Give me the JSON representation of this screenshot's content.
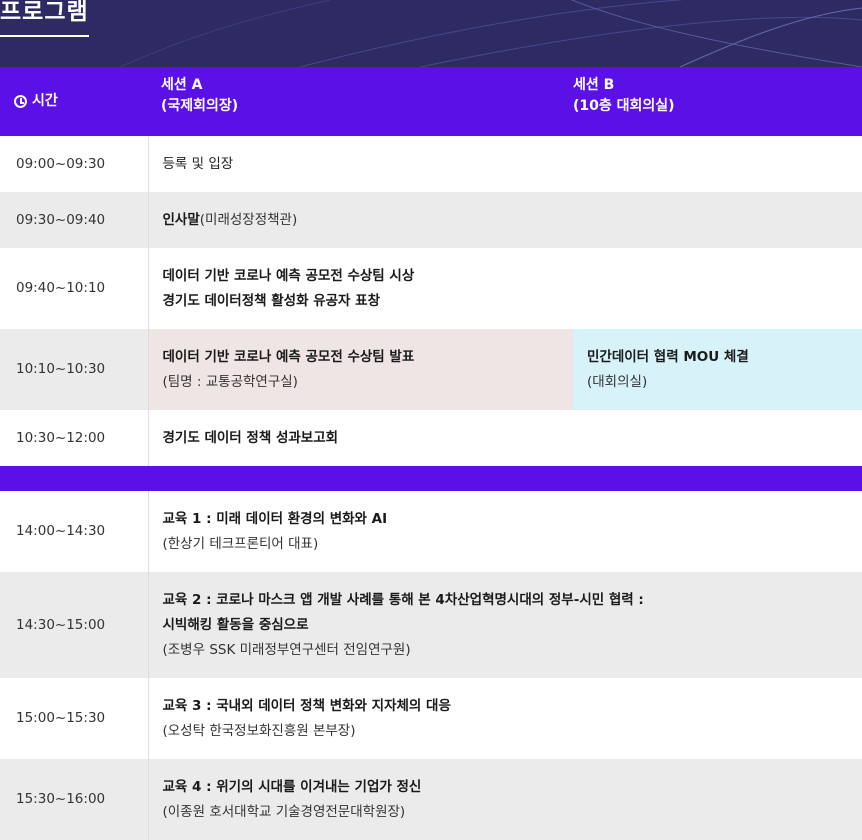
{
  "header": {
    "title": "프로그램"
  },
  "table": {
    "time_header": "시간",
    "session_a_header": [
      "세션 A",
      "(국제회의장)"
    ],
    "session_b_header": [
      "세션 B",
      "(10층 대회의실)"
    ],
    "rows": [
      {
        "time": "09:00~09:30",
        "a": {
          "plain": "등록 및 입장"
        }
      },
      {
        "time": "09:30~09:40",
        "a": {
          "bold": "인사말",
          "suffix": "(미래성장정책관)"
        }
      },
      {
        "time": "09:40~10:10",
        "a": {
          "line1": "데이터 기반 코로나 예측 공모전 수상팀 시상",
          "line2": "경기도 데이터정책 활성화 유공자 표창"
        }
      },
      {
        "time": "10:10~10:30",
        "a": {
          "bold": "데이터 기반 코로나 예측 공모전 수상팀 발표",
          "sub": "(팀명 : 교통공학연구실)"
        },
        "b": {
          "bold": "민간데이터 협력 MOU 체결",
          "sub": "(대회의실)"
        }
      },
      {
        "time": "10:30~12:00",
        "a": {
          "bold": "경기도 데이터 정책 성과보고회"
        }
      },
      {
        "time": "14:00~14:30",
        "a": {
          "bold": "교육 1 : 미래 데이터 환경의 변화와 AI",
          "sub": "(한상기 테크프론티어 대표)"
        }
      },
      {
        "time": "14:30~15:00",
        "a": {
          "bold": "교육 2 : 코로나 마스크 앱 개발 사례를 통해 본 4차산업혁명시대의 정부-시민 협력 :",
          "bold2": "시빅해킹 활동을 중심으로",
          "sub": "(조병우 SSK 미래정부연구센터 전임연구원)"
        }
      },
      {
        "time": "15:00~15:30",
        "a": {
          "bold": "교육 3 : 국내외 데이터 정책 변화와 지자체의 대응",
          "sub": "(오성탁 한국정보화진흥원 본부장)"
        }
      },
      {
        "time": "15:30~16:00",
        "a": {
          "bold": "교육 4 : 위기의 시대를 이겨내는 기업가 정신",
          "sub": "(이종원 호서대학교 기술경영전문대학원장)"
        }
      }
    ]
  },
  "colors": {
    "header_purple": "#5a10e6",
    "hero_bg": "#2e2b63",
    "pink_cell": "#efe5e5",
    "cyan_cell": "#d7f2f8",
    "gray_row": "#ebebeb"
  },
  "icons": {
    "time": "clock-icon"
  }
}
